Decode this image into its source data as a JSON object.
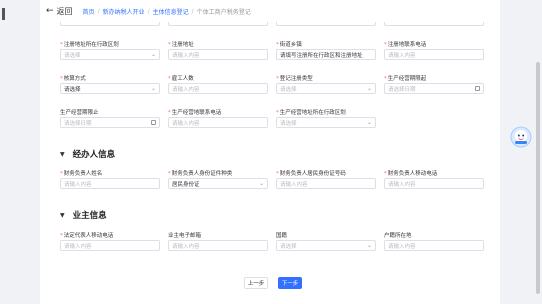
{
  "header": {
    "back_label": "返回",
    "breadcrumbs": [
      "首页",
      "新办纳税人开业",
      "主体信息登记",
      "个体工商户税务登记"
    ]
  },
  "section1": {
    "row1": [
      {
        "label": "注册地址所在行政区划",
        "required": true,
        "value": "请选择",
        "filled": false,
        "kind": "select"
      },
      {
        "label": "注册地址",
        "required": true,
        "value": "请输入内容",
        "filled": false,
        "kind": "text"
      },
      {
        "label": "街道乡镇",
        "required": true,
        "value": "请填写注册所在行政区和注册地址",
        "filled": true,
        "kind": "select"
      },
      {
        "label": "注册地联系电话",
        "required": true,
        "value": "请输入内容",
        "filled": false,
        "kind": "text"
      }
    ],
    "row2": [
      {
        "label": "核算方式",
        "required": true,
        "value": "请选择",
        "filled": true,
        "kind": "select"
      },
      {
        "label": "雇工人数",
        "required": true,
        "value": "请输入内容",
        "filled": false,
        "kind": "text"
      },
      {
        "label": "登记注册类型",
        "required": true,
        "value": "请选择",
        "filled": false,
        "kind": "select"
      },
      {
        "label": "生产经营期限起",
        "required": true,
        "value": "请选择日期",
        "filled": false,
        "kind": "date"
      }
    ],
    "row3": [
      {
        "label": "生产经营期限止",
        "required": false,
        "value": "请选择日期",
        "filled": false,
        "kind": "date"
      },
      {
        "label": "生产经营地联系电话",
        "required": true,
        "value": "请输入内容",
        "filled": false,
        "kind": "text"
      },
      {
        "label": "生产经营地址所在行政区划",
        "required": true,
        "value": "请选择",
        "filled": false,
        "kind": "select"
      }
    ]
  },
  "section2": {
    "title": "经办人信息",
    "fields": [
      {
        "label": "财务负责人姓名",
        "required": true,
        "value": "请输入内容",
        "filled": false,
        "kind": "text"
      },
      {
        "label": "财务负责人身份证件种类",
        "required": true,
        "value": "居民身份证",
        "filled": true,
        "kind": "select"
      },
      {
        "label": "财务负责人居民身份证号码",
        "required": true,
        "value": "请输入内容",
        "filled": false,
        "kind": "text"
      },
      {
        "label": "财务负责人移动电话",
        "required": true,
        "value": "请输入内容",
        "filled": false,
        "kind": "text"
      }
    ]
  },
  "section3": {
    "title": "业主信息",
    "fields": [
      {
        "label": "法定代表人移动电话",
        "required": true,
        "value": "请输入内容",
        "filled": false,
        "kind": "text"
      },
      {
        "label": "业主电子邮箱",
        "required": false,
        "value": "请输入内容",
        "filled": false,
        "kind": "text"
      },
      {
        "label": "国籍",
        "required": false,
        "value": "请选择",
        "filled": false,
        "kind": "select"
      },
      {
        "label": "户籍所在地",
        "required": false,
        "value": "请输入内容",
        "filled": false,
        "kind": "text"
      }
    ]
  },
  "footer": {
    "prev_label": "上一步",
    "next_label": "下一步"
  },
  "colors": {
    "accent": "#3370ff",
    "required": "#f56c6c",
    "border": "#dcdfe6"
  }
}
